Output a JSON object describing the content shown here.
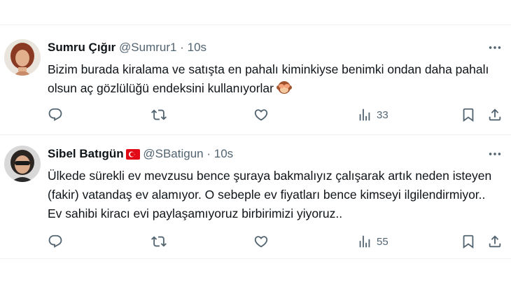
{
  "tweets": [
    {
      "name": "Sumru Çığır",
      "handle": "@Sumrur1",
      "separator": "·",
      "time": "10s",
      "text": "Bizim burada kiralama ve satışta en pahalı kiminkiyse benimki ondan daha pahalı olsun aç gözlülüğü endeksini kullanıyorlar",
      "emoji": "see-no-evil-monkey",
      "views": "33",
      "avatar": "woman-portrait-red-hair"
    },
    {
      "name": "Sibel Batıgün",
      "handle": "@SBatigun",
      "separator": "·",
      "time": "10s",
      "badge": "turkey-flag",
      "text": "Ülkede sürekli ev mevzusu bence şuraya bakmalıyız çalışarak artık neden isteyen (fakir) vatandaş ev alamıyor. O sebeple ev fiyatları bence kimseyi ilgilendirmiyor.. Ev sahibi kiracı evi paylaşamıyoruz birbirimizi yiyoruz..",
      "views": "55",
      "avatar": "woman-portrait-sunglasses"
    }
  ],
  "colors": {
    "text": "#0f1419",
    "secondary": "#536471",
    "divider": "#eff3f4"
  }
}
